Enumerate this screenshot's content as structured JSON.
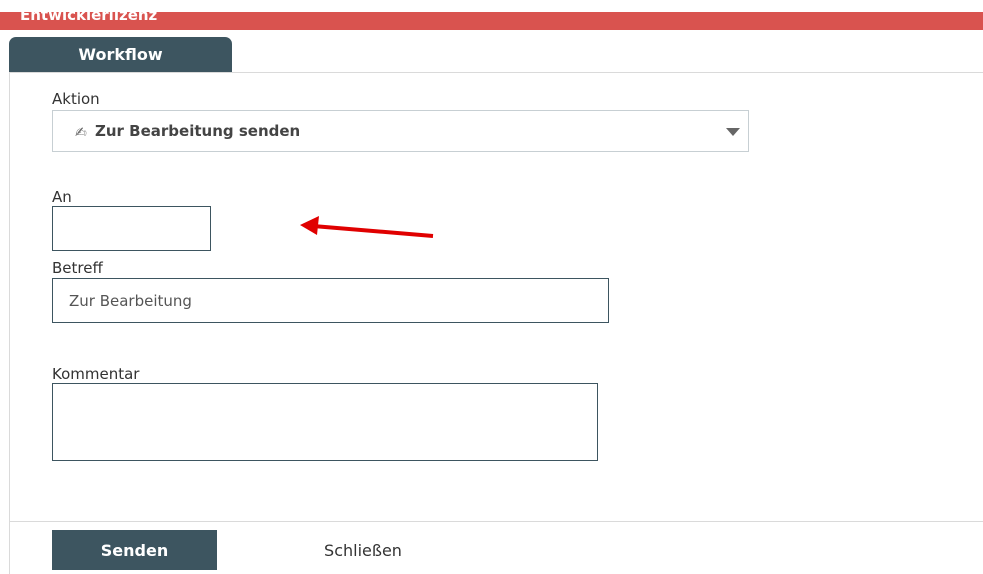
{
  "banner": {
    "text": "Entwicklerlizenz",
    "color": "#d9534f"
  },
  "tab": {
    "label": "Workflow"
  },
  "form": {
    "aktion_label": "Aktion",
    "aktion_icon": "send-document-icon",
    "aktion_value": "Zur Bearbeitung senden",
    "an_label": "An",
    "an_value": "",
    "betreff_label": "Betreff",
    "betreff_value": "Zur Bearbeitung",
    "kommentar_label": "Kommentar",
    "kommentar_value": ""
  },
  "annotation": {
    "arrow_color": "#e00000"
  },
  "actions": {
    "send_label": "Senden",
    "close_label": "Schließen"
  },
  "colors": {
    "primary": "#3d5560",
    "banner": "#d9534f"
  }
}
